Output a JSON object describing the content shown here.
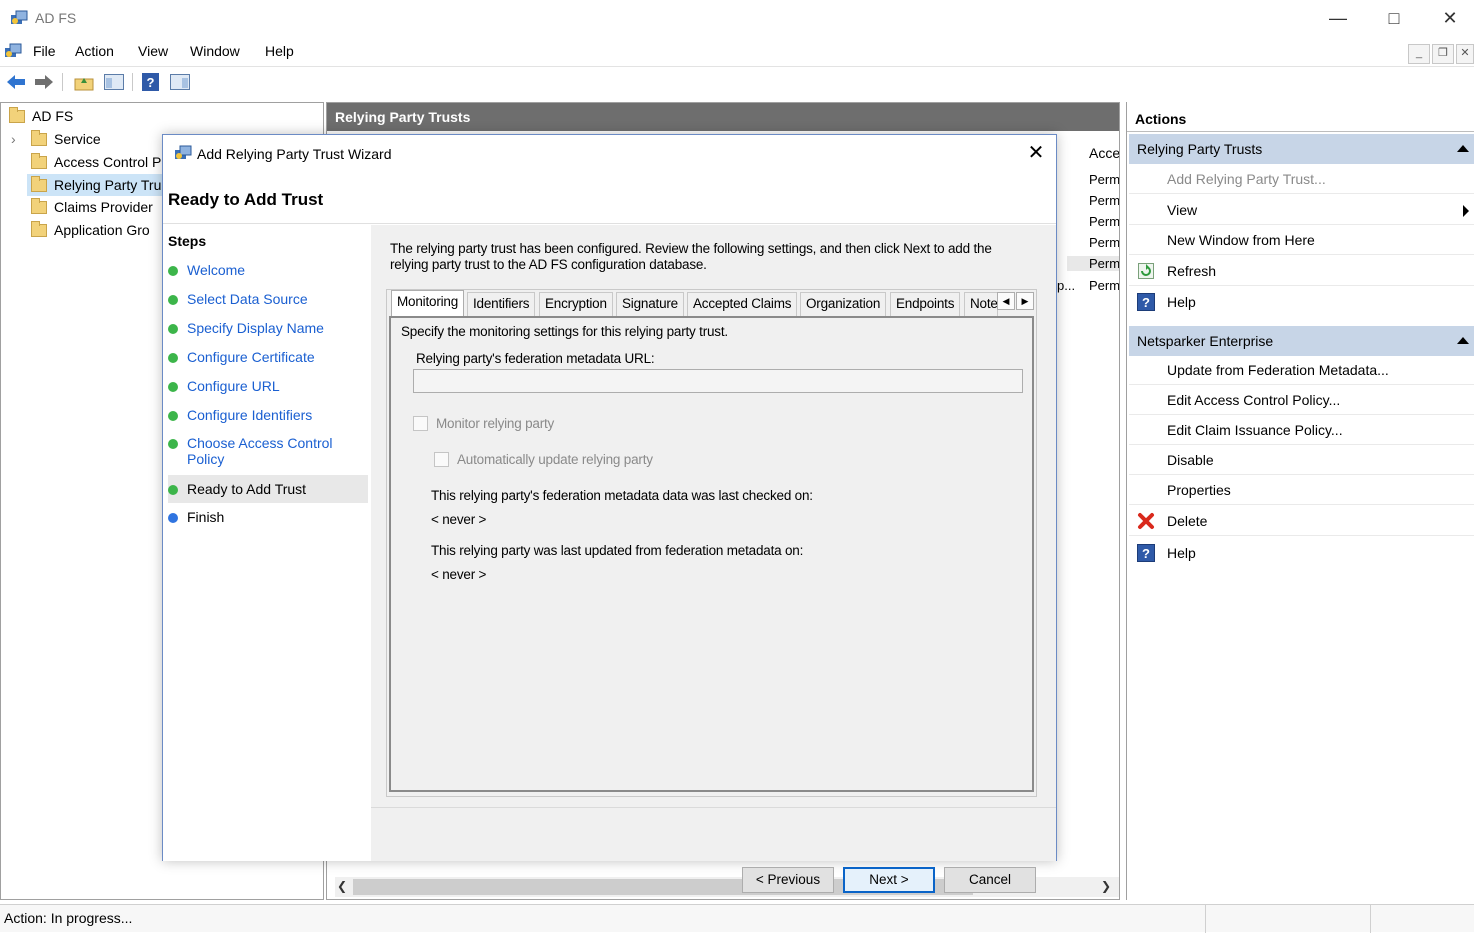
{
  "window": {
    "title": "AD FS"
  },
  "menubar": {
    "items": [
      "File",
      "Action",
      "View",
      "Window",
      "Help"
    ]
  },
  "tree": {
    "items": [
      {
        "label": "AD FS"
      },
      {
        "label": "Service"
      },
      {
        "label": "Access Control P"
      },
      {
        "label": "Relying Party Tru"
      },
      {
        "label": "Claims Provider"
      },
      {
        "label": "Application Gro"
      }
    ]
  },
  "middle": {
    "header": "Relying Party Trusts",
    "column_header": "Acce",
    "cells": [
      "Perm",
      "Perm",
      "Perm",
      "Perm",
      "Perm",
      "Perm"
    ],
    "fragment": "p..."
  },
  "actions": {
    "title": "Actions",
    "section1": {
      "label": "Relying Party Trusts"
    },
    "section1_items": [
      {
        "label": "Add Relying Party Trust..."
      },
      {
        "label": "View"
      },
      {
        "label": "New Window from Here"
      },
      {
        "label": "Refresh"
      },
      {
        "label": "Help"
      }
    ],
    "section2": {
      "label": "Netsparker Enterprise"
    },
    "section2_items": [
      {
        "label": "Update from Federation Metadata..."
      },
      {
        "label": "Edit Access Control Policy..."
      },
      {
        "label": "Edit Claim Issuance Policy..."
      },
      {
        "label": "Disable"
      },
      {
        "label": "Properties"
      },
      {
        "label": "Delete"
      },
      {
        "label": "Help"
      }
    ]
  },
  "status": {
    "text": "Action:  In progress..."
  },
  "dialog": {
    "title": "Add Relying Party Trust Wizard",
    "heading": "Ready to Add Trust",
    "steps_title": "Steps",
    "steps": [
      {
        "label": "Welcome"
      },
      {
        "label": "Select Data Source"
      },
      {
        "label": "Specify Display Name"
      },
      {
        "label": "Configure Certificate"
      },
      {
        "label": "Configure URL"
      },
      {
        "label": "Configure Identifiers"
      },
      {
        "label": "Choose Access Control Policy"
      },
      {
        "label": "Ready to Add Trust"
      },
      {
        "label": "Finish"
      }
    ],
    "intro": "The relying party trust has been configured. Review the following settings, and then click Next to add the relying party trust to the AD FS configuration database.",
    "tabs": [
      {
        "label": "Monitoring"
      },
      {
        "label": "Identifiers"
      },
      {
        "label": "Encryption"
      },
      {
        "label": "Signature"
      },
      {
        "label": "Accepted Claims"
      },
      {
        "label": "Organization"
      },
      {
        "label": "Endpoints"
      },
      {
        "label": "Note"
      }
    ],
    "monitoring": {
      "description": "Specify the monitoring settings for this relying party trust.",
      "url_label": "Relying party's federation metadata URL:",
      "url_value": "",
      "monitor_label": "Monitor relying party",
      "monitor_checked": false,
      "auto_update_label": "Automatically update relying party",
      "auto_update_checked": false,
      "last_checked_label": "This relying party's federation metadata data was last checked on:",
      "last_checked_value": "< never >",
      "last_updated_label": "This relying party was last updated from federation metadata on:",
      "last_updated_value": "< never >"
    },
    "buttons": {
      "previous": "< Previous",
      "next": "Next >",
      "cancel": "Cancel"
    }
  }
}
